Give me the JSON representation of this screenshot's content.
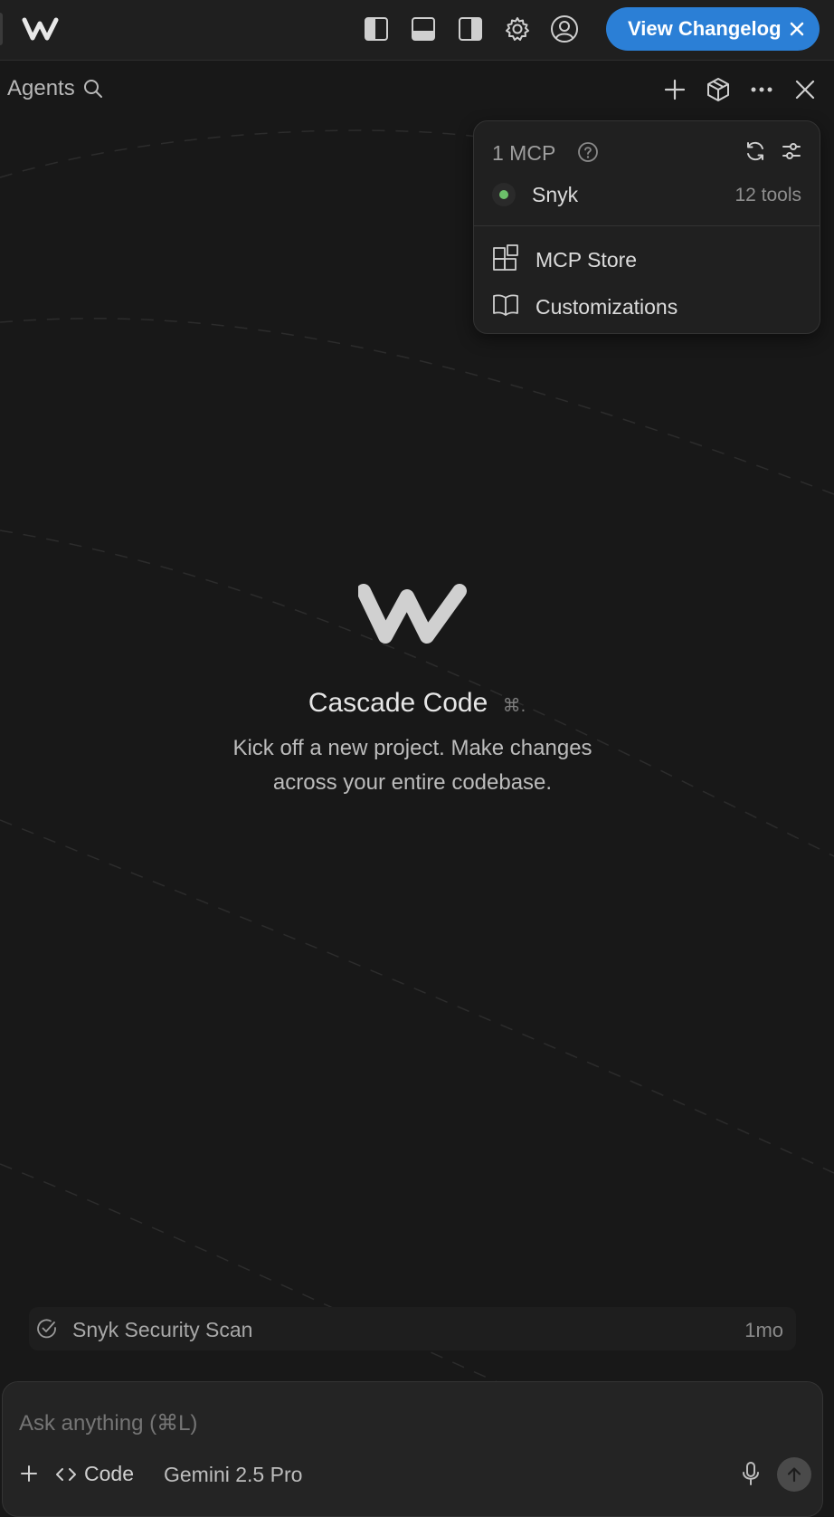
{
  "titlebar": {
    "changelog_label": "View Changelog"
  },
  "panel": {
    "title": "Agents"
  },
  "mcp_popup": {
    "title": "1 MCP",
    "servers": [
      {
        "name": "Snyk",
        "tools": "12 tools",
        "status_color": "#6cc06a"
      }
    ],
    "items": [
      {
        "label": "MCP Store",
        "icon": "grid-plus-icon"
      },
      {
        "label": "Customizations",
        "icon": "book-icon"
      }
    ]
  },
  "hero": {
    "title_bold": "Cascade",
    "title_rest": "Code",
    "shortcut": "⌘.",
    "subtitle_line1": "Kick off a new project. Make changes",
    "subtitle_line2": "across your entire codebase."
  },
  "recent": [
    {
      "label": "Snyk Security Scan",
      "age": "1mo"
    }
  ],
  "composer": {
    "placeholder": "Ask anything (⌘L)",
    "mode_label": "Code",
    "model_label": "Gemini 2.5 Pro"
  },
  "colors": {
    "accent": "#2b7fd6",
    "background": "#181818",
    "status_ok": "#6cc06a"
  }
}
